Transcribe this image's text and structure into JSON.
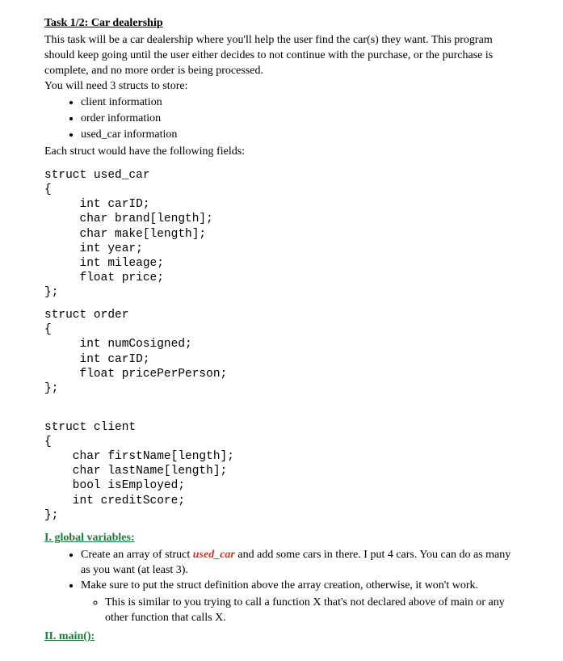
{
  "title": "Task 1/2:  Car dealership",
  "intro": "This task will be a car dealership where you'll help the user find the car(s) they want. This program should keep going until the user either decides to not continue with the purchase, or the purchase is complete, and no more order is being processed.",
  "need_line": "You will need 3 structs to store:",
  "struct_list": [
    "client information",
    "order information",
    "used_car information"
  ],
  "each_line": "Each struct would have the following fields:",
  "code_used_car": "struct used_car\n{\n     int carID;\n     char brand[length];\n     char make[length];\n     int year;\n     int mileage;\n     float price;\n};",
  "code_order": "struct order\n{\n     int numCosigned;\n     int carID;\n     float pricePerPerson;\n};",
  "code_client": "struct client\n{\n    char firstName[length];\n    char lastName[length];\n    bool isEmployed;\n    int creditScore;\n};",
  "sec1": "I. global variables:",
  "gv_bullet1_pre": "Create an array of struct ",
  "gv_bullet1_em": "used_car",
  "gv_bullet1_post": " and add some cars in there. I put 4 cars. You can do as many as you want (at least 3).",
  "gv_bullet2": "Make sure to put the struct definition above the array creation, otherwise, it won't work.",
  "gv_sub": "This is similar to you trying to call a function X that's not declared above of main or any other function that calls X.",
  "sec2": "II. main():"
}
